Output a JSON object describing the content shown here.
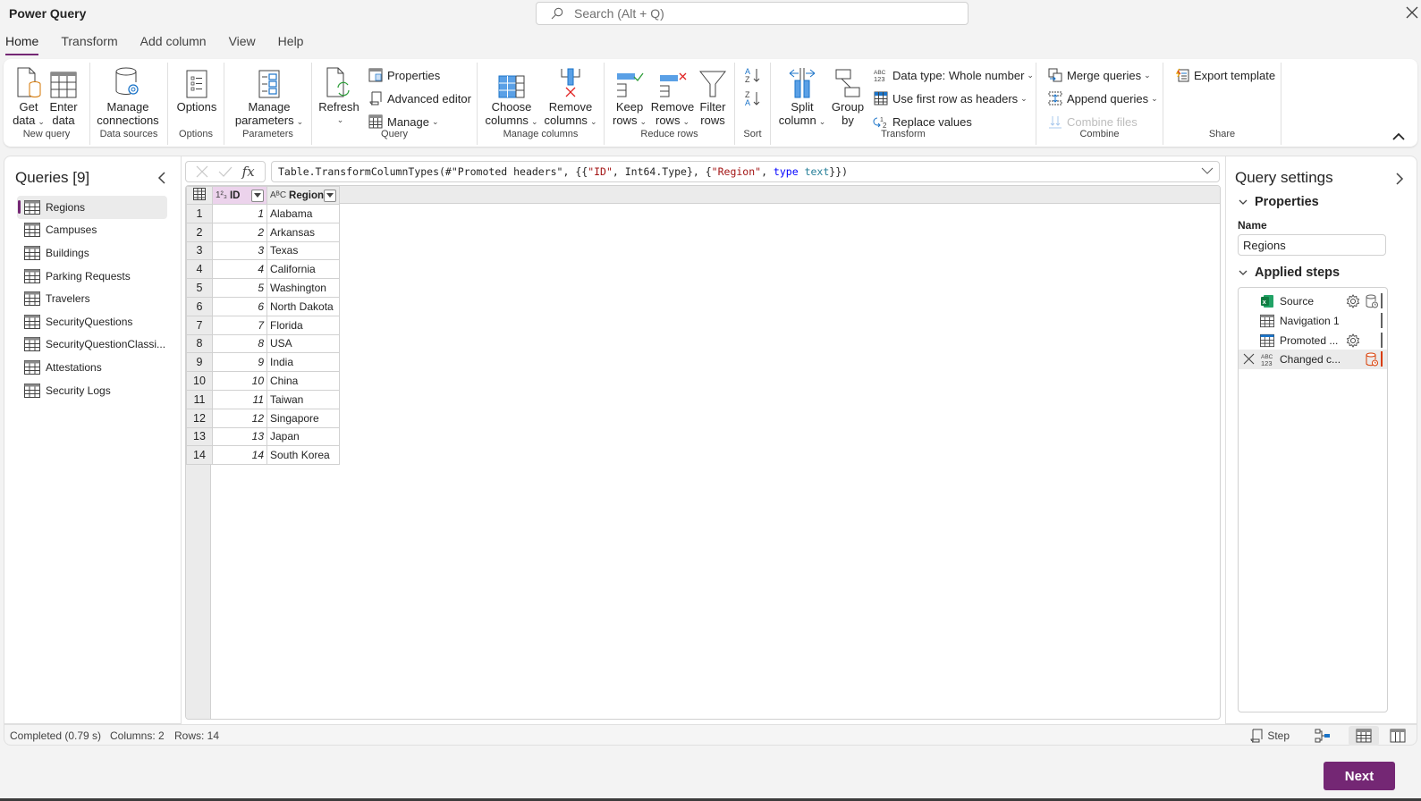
{
  "app": {
    "title": "Power Query",
    "search_placeholder": "Search (Alt + Q)"
  },
  "tabs": [
    {
      "label": "Home",
      "active": true
    },
    {
      "label": "Transform",
      "active": false
    },
    {
      "label": "Add column",
      "active": false
    },
    {
      "label": "View",
      "active": false
    },
    {
      "label": "Help",
      "active": false
    }
  ],
  "ribbon": {
    "groups": {
      "new_query": "New query",
      "data_sources": "Data sources",
      "options": "Options",
      "parameters": "Parameters",
      "query": "Query",
      "manage_columns": "Manage columns",
      "reduce_rows": "Reduce rows",
      "sort": "Sort",
      "transform": "Transform",
      "combine": "Combine",
      "share": "Share"
    },
    "buttons": {
      "get_data": [
        "Get",
        "data"
      ],
      "enter_data": [
        "Enter",
        "data"
      ],
      "manage_connections": [
        "Manage",
        "connections"
      ],
      "options": "Options",
      "manage_parameters": [
        "Manage",
        "parameters"
      ],
      "refresh": "Refresh",
      "properties": "Properties",
      "advanced_editor": "Advanced editor",
      "manage": "Manage",
      "choose_columns": [
        "Choose",
        "columns"
      ],
      "remove_columns": [
        "Remove",
        "columns"
      ],
      "keep_rows": [
        "Keep",
        "rows"
      ],
      "remove_rows": [
        "Remove",
        "rows"
      ],
      "filter_rows": [
        "Filter",
        "rows"
      ],
      "split_column": [
        "Split",
        "column"
      ],
      "group_by": [
        "Group",
        "by"
      ],
      "data_type": "Data type: Whole number",
      "use_first_row": "Use first row as headers",
      "replace_values": "Replace values",
      "merge_queries": "Merge queries",
      "append_queries": "Append queries",
      "combine_files": "Combine files",
      "export_template": "Export template"
    }
  },
  "queries": {
    "title": "Queries [9]",
    "items": [
      {
        "label": "Regions",
        "selected": true
      },
      {
        "label": "Campuses",
        "selected": false
      },
      {
        "label": "Buildings",
        "selected": false
      },
      {
        "label": "Parking Requests",
        "selected": false
      },
      {
        "label": "Travelers",
        "selected": false
      },
      {
        "label": "SecurityQuestions",
        "selected": false
      },
      {
        "label": "SecurityQuestionClassi...",
        "selected": false
      },
      {
        "label": "Attestations",
        "selected": false
      },
      {
        "label": "Security Logs",
        "selected": false
      }
    ]
  },
  "formula": {
    "fx_label": "fx",
    "parts": [
      {
        "t": "Table.TransformColumnTypes(#\"Promoted headers\", {{",
        "c": ""
      },
      {
        "t": "\"ID\"",
        "c": "f-str"
      },
      {
        "t": ", Int64.Type}, {",
        "c": ""
      },
      {
        "t": "\"Region\"",
        "c": "f-str"
      },
      {
        "t": ", ",
        "c": ""
      },
      {
        "t": "type",
        "c": "f-kw"
      },
      {
        "t": " ",
        "c": ""
      },
      {
        "t": "text",
        "c": "f-typ"
      },
      {
        "t": "}})",
        "c": ""
      }
    ]
  },
  "grid": {
    "columns": [
      {
        "name": "ID",
        "type_icon": "1²₃"
      },
      {
        "name": "Region",
        "type_icon": "AᴮC"
      }
    ],
    "rows": [
      {
        "n": "1",
        "id": "1",
        "region": "Alabama"
      },
      {
        "n": "2",
        "id": "2",
        "region": "Arkansas"
      },
      {
        "n": "3",
        "id": "3",
        "region": "Texas"
      },
      {
        "n": "4",
        "id": "4",
        "region": "California"
      },
      {
        "n": "5",
        "id": "5",
        "region": "Washington"
      },
      {
        "n": "6",
        "id": "6",
        "region": "North Dakota"
      },
      {
        "n": "7",
        "id": "7",
        "region": "Florida"
      },
      {
        "n": "8",
        "id": "8",
        "region": "USA"
      },
      {
        "n": "9",
        "id": "9",
        "region": "India"
      },
      {
        "n": "10",
        "id": "10",
        "region": "China"
      },
      {
        "n": "11",
        "id": "11",
        "region": "Taiwan"
      },
      {
        "n": "12",
        "id": "12",
        "region": "Singapore"
      },
      {
        "n": "13",
        "id": "13",
        "region": "Japan"
      },
      {
        "n": "14",
        "id": "14",
        "region": "South Korea"
      }
    ]
  },
  "query_settings": {
    "title": "Query settings",
    "properties_label": "Properties",
    "name_label": "Name",
    "name_value": "Regions",
    "applied_steps_label": "Applied steps",
    "steps": [
      {
        "label": "Source",
        "icon": "excel-icon",
        "gear": true,
        "db": true,
        "selected": false
      },
      {
        "label": "Navigation 1",
        "icon": "table-icon",
        "gear": false,
        "db": false,
        "selected": false
      },
      {
        "label": "Promoted ...",
        "icon": "table-blue-icon",
        "gear": true,
        "db": false,
        "selected": false
      },
      {
        "label": "Changed c...",
        "icon": "abc123-icon",
        "gear": false,
        "db": true,
        "selected": true
      }
    ]
  },
  "status": {
    "completed": "Completed (0.79 s)",
    "columns": "Columns: 2",
    "rows": "Rows: 14",
    "step_label": "Step"
  },
  "footer": {
    "next_label": "Next"
  },
  "colors": {
    "accent": "#742774",
    "id_header": "#ecd3ec",
    "error_step": "#d83b01"
  }
}
